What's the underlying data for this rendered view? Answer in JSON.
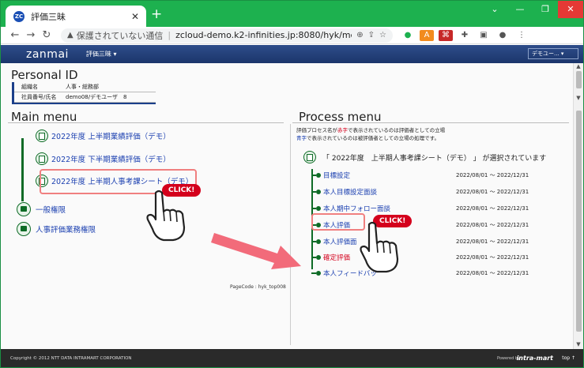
{
  "browser": {
    "tab_title": "評価三昧",
    "tab_close": "✕",
    "new_tab": "+",
    "insecure_label": "保護されていない通信",
    "url": "zcloud-demo.k2-infinities.jp:8080/hyk/menu/common/if···",
    "window_controls": [
      "⌄",
      "—",
      "❐",
      "✕"
    ]
  },
  "app": {
    "logo": "zanmai",
    "menu_dropdown": "評価三昧 ▾",
    "user_dropdown": "デモユー... ▾"
  },
  "personal": {
    "title": "Personal ID",
    "rows": [
      {
        "key": "組織名",
        "value": "人事・総務部"
      },
      {
        "key": "社員番号/氏名",
        "value": "demo08/デモユーザ　8"
      }
    ]
  },
  "main_menu": {
    "title": "Main menu",
    "items": [
      "2022年度 上半期業績評価（デモ）",
      "2022年度 下半期業績評価（デモ）",
      "2022年度 上半期人事考課シート（デモ）"
    ],
    "admin_items": [
      "一般権限",
      "人事評価業務権限"
    ],
    "page_code": "PageCode : hyk_top008"
  },
  "process_menu": {
    "title": "Process menu",
    "note1_pre": "評価プロセス名が",
    "note1_red": "赤字",
    "note1_post": "で表示されているのは評価者としての立場",
    "note2_blue": "青字",
    "note2_post": "で表示されているのは被評価者としての立場の処理です。",
    "selected": "「 2022年度　上半期人事考課シート（デモ） 」 が選択されています",
    "items": [
      {
        "label": "目標設定",
        "date": "2022/08/01 ～ 2022/12/31",
        "red": false
      },
      {
        "label": "本人目標設定面談",
        "date": "2022/08/01 ～ 2022/12/31",
        "red": false
      },
      {
        "label": "本人期中フォロー面談",
        "date": "2022/08/01 ～ 2022/12/31",
        "red": false
      },
      {
        "label": "本人評価",
        "date": "2022/08/01 ～ 2022/12/31",
        "red": false
      },
      {
        "label": "本人評価面",
        "date": "2022/08/01 ～ 2022/12/31",
        "red": false
      },
      {
        "label": "確定評価",
        "date": "2022/08/01 ～ 2022/12/31",
        "red": true
      },
      {
        "label": "本人フィードバッ",
        "date": "2022/08/01 ～ 2022/12/31",
        "red": false
      }
    ]
  },
  "annotation": {
    "click_label": "CLICK!"
  },
  "footer": {
    "copyright": "Copyright © 2012 NTT DATA INTRAMART CORPORATION",
    "powered": "Powered by",
    "brand": "intra-mart",
    "top": "top ↑"
  },
  "colors": {
    "chrome_green": "#1db14f",
    "nav_blue": "#1b356b",
    "link_blue": "#1a3fb0",
    "tree_green": "#0e6b26",
    "accent_red": "#d4001c",
    "highlight_pink": "#f08080"
  }
}
